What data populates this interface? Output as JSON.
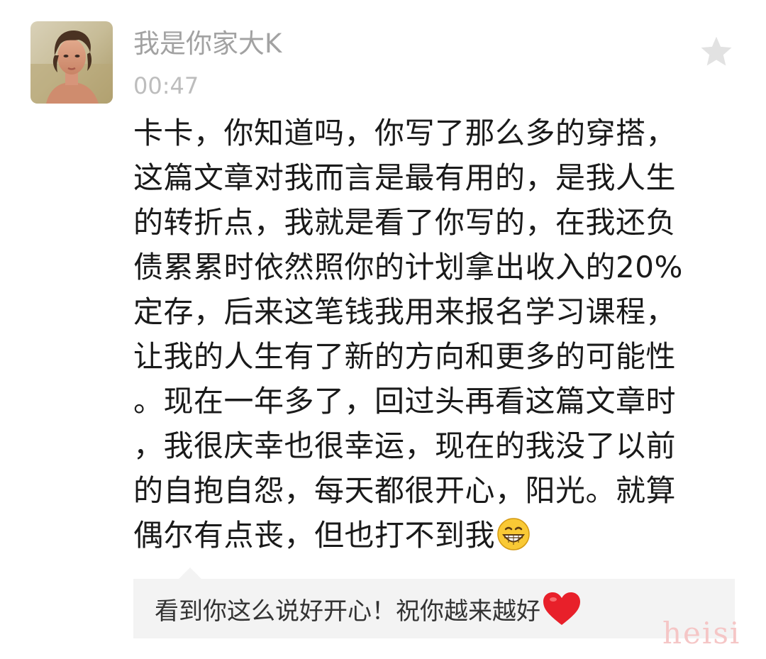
{
  "post": {
    "username": "我是你家大K",
    "timestamp": "00:47",
    "avatar_icon": "user-avatar-photo",
    "favorite_icon": "star-icon",
    "body_lines": [
      "卡卡，你知道吗，你写了那么多的穿搭，",
      "这篇文章对我而言是最有用的，是我人生",
      "的转折点，我就是看了你写的，在我还负",
      "债累累时依然照你的计划拿出收入的20%",
      "定存，后来这笔钱我用来报名学习课程，",
      "让我的人生有了新的方向和更多的可能性",
      "。现在一年多了，回过头再看这篇文章时",
      "，我很庆幸也很幸运，现在的我没了以前",
      "的自抱自怨，每天都很开心，阳光。就算",
      "偶尔有点丧，但也打不到我"
    ],
    "body_end_emoji": "grinning-emoji"
  },
  "reply": {
    "text": "看到你这么说好开心！祝你越来越好",
    "end_emoji": "red-heart-emoji"
  },
  "watermark": "heisi",
  "colors": {
    "username": "#a2a2a2",
    "timestamp": "#bdbdbd",
    "body_text": "#1a1a1a",
    "reply_background": "#f3f3f3",
    "star": "#e2e2e2",
    "heart": "#e8202a",
    "watermark": "#f5c6c6"
  }
}
